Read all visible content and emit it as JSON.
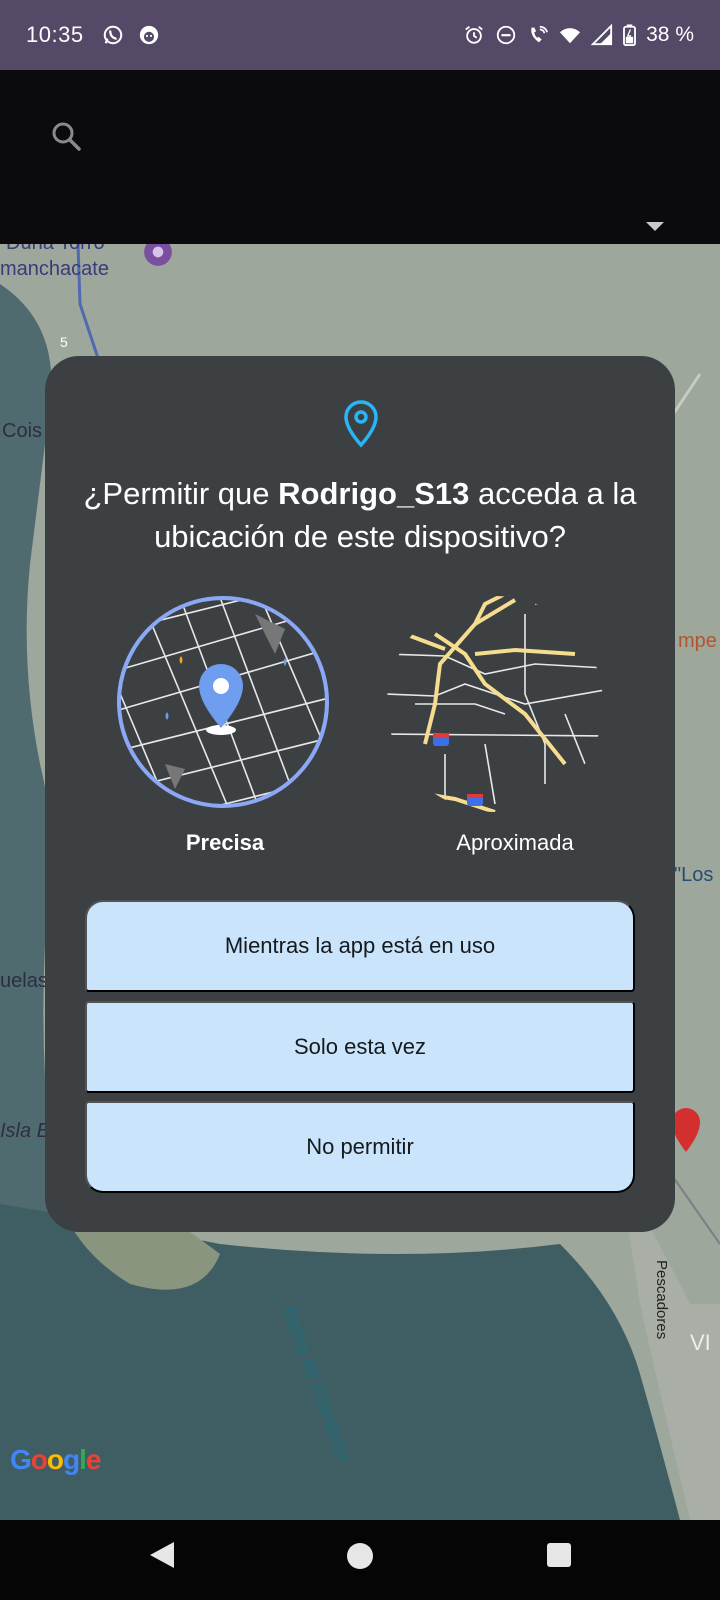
{
  "status_bar": {
    "time": "10:35",
    "left_icons": [
      "whatsapp-icon",
      "app-face-icon"
    ],
    "right_icons": [
      "alarm-icon",
      "dnd-icon",
      "wifi-call-icon",
      "wifi-icon",
      "signal-icon",
      "battery-icon"
    ],
    "battery": "38 %"
  },
  "app_bar": {
    "search_icon": "search-icon",
    "dropdown_icon": "triangle-down-icon"
  },
  "map": {
    "labels": [
      {
        "id": "duna",
        "text": "Duna Torro"
      },
      {
        "id": "manchacate",
        "text": "manchacate"
      },
      {
        "id": "road5",
        "text": "5"
      },
      {
        "id": "cois",
        "text": "Cois"
      },
      {
        "id": "mpe",
        "text": "mpe"
      },
      {
        "id": "los",
        "text": "\"Los"
      },
      {
        "id": "uelas",
        "text": "uelas"
      },
      {
        "id": "isla",
        "text": "Isla E"
      },
      {
        "id": "bahia",
        "text": "Bahía de Chimbote"
      },
      {
        "id": "pescadores",
        "text": "Pescadores"
      },
      {
        "id": "vi",
        "text": "VI"
      }
    ],
    "google": [
      "G",
      "o",
      "o",
      "g",
      "l",
      "e"
    ]
  },
  "dialog": {
    "title_prefix": "¿Permitir que ",
    "app_name": "Rodrigo_S13",
    "title_suffix": " acceda a la ubicación de este dispositivo?",
    "options": {
      "precise": "Precisa",
      "approximate": "Aproximada"
    },
    "buttons": {
      "while_in_use": "Mientras la app está en uso",
      "only_this_time": "Solo esta vez",
      "deny": "No permitir"
    },
    "colors": {
      "accent": "#29b6f6",
      "button_bg": "#c9e4fb",
      "dialog_bg": "#3d4043"
    }
  },
  "nav_bar": {
    "icons": [
      "back-icon",
      "home-icon",
      "recents-icon"
    ]
  }
}
